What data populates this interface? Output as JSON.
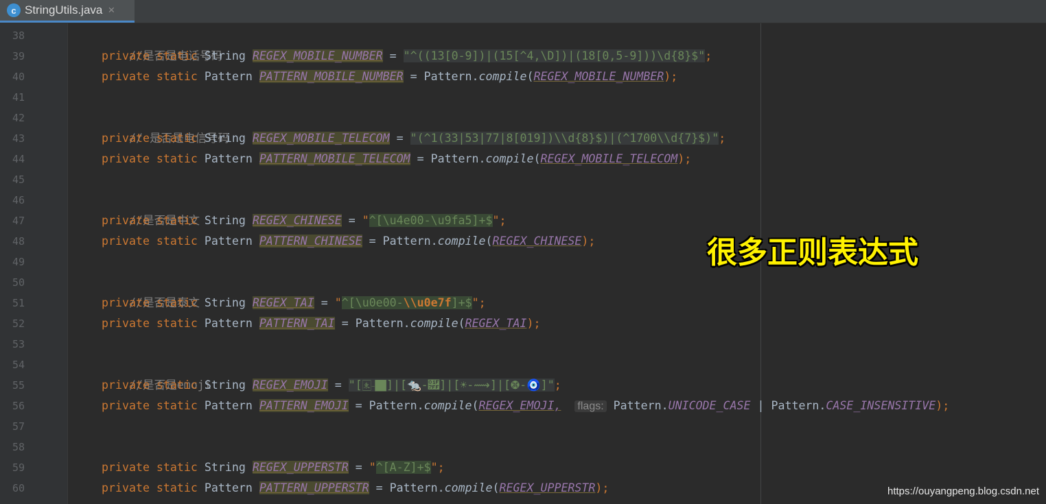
{
  "tab": {
    "icon_letter": "c",
    "icon": "class-icon",
    "title": "StringUtils.java",
    "close": "×"
  },
  "lines": [
    "38",
    "39",
    "40",
    "41",
    "42",
    "43",
    "44",
    "45",
    "46",
    "47",
    "48",
    "49",
    "50",
    "51",
    "52",
    "53",
    "54",
    "55",
    "56",
    "57",
    "58",
    "59",
    "60"
  ],
  "code": {
    "l38": {
      "comment": "//是否是电话号码"
    },
    "l39": {
      "kw": "private static",
      "type": "String",
      "field": "REGEX_MOBILE_NUMBER",
      "eq": " = ",
      "str": "\"^((13[0-9])|(15[^4,\\D])|(18[0,5-9]))\\d{8}$\"",
      "end": ";"
    },
    "l40": {
      "kw": "private static",
      "type": "Pattern",
      "field": "PATTERN_MOBILE_NUMBER",
      "eq": " = ",
      "call": "Pattern.",
      "method": "compile",
      "open": "(",
      "arg": "REGEX_MOBILE_NUMBER",
      "end": ");"
    },
    "l42": {
      "comment": "// 是否是电信号码"
    },
    "l43": {
      "kw": "private static",
      "type": "String",
      "field": "REGEX_MOBILE_TELECOM",
      "eq": " = ",
      "str": "\"(^1(33|53|77|8[019])\\\\d{8}$)|(^1700\\\\d{7}$)\"",
      "end": ";"
    },
    "l44": {
      "kw": "private static",
      "type": "Pattern",
      "field": "PATTERN_MOBILE_TELECOM",
      "eq": " = ",
      "call": "Pattern.",
      "method": "compile",
      "open": "(",
      "arg": "REGEX_MOBILE_TELECOM",
      "end": ");"
    },
    "l46": {
      "comment": "//是否是中文"
    },
    "l47": {
      "kw": "private static",
      "type": "String",
      "field": "REGEX_CHINESE",
      "eq": " = ",
      "q1": "\"",
      "str": "^[\\u4e00-\\u9fa5]+$",
      "q2": "\"",
      "end": ";"
    },
    "l48": {
      "kw": "private static",
      "type": "Pattern",
      "field": "PATTERN_CHINESE",
      "eq": " = ",
      "call": "Pattern.",
      "method": "compile",
      "open": "(",
      "arg": "REGEX_CHINESE",
      "end": ");"
    },
    "l50": {
      "comment": "//是否是泰文"
    },
    "l51": {
      "kw": "private static",
      "type": "String",
      "field": "REGEX_TAI",
      "eq": " = ",
      "q1": "\"",
      "str": "^[\\u0e00-",
      "esc": "\\\\u0e7f",
      "str2": "]+$",
      "q2": "\"",
      "end": ";"
    },
    "l52": {
      "kw": "private static",
      "type": "Pattern",
      "field": "PATTERN_TAI",
      "eq": " = ",
      "call": "Pattern.",
      "method": "compile",
      "open": "(",
      "arg": "REGEX_TAI",
      "end": ");"
    },
    "l54": {
      "comment": "//是否是emoji"
    },
    "l55": {
      "kw": "private static",
      "type": "String",
      "field": "REGEX_EMOJI",
      "eq": " = ",
      "str": "\"[🀀-🏿]|[🐀-🟿]|[☀-⟿]|[🤀-🧿]\"",
      "end": ";"
    },
    "l56": {
      "kw": "private static",
      "type": "Pattern",
      "field": "PATTERN_EMOJI",
      "eq": " = ",
      "call": "Pattern.",
      "method": "compile",
      "open": "(",
      "arg": "REGEX_EMOJI,",
      "hint": "flags:",
      "p1": "Pattern.",
      "c1": "UNICODE_CASE",
      "or": " | ",
      "p2": "Pattern.",
      "c2": "CASE_INSENSITIVE",
      "end": ");"
    },
    "l59": {
      "kw": "private static",
      "type": "String",
      "field": "REGEX_UPPERSTR",
      "eq": " = ",
      "q1": "\"",
      "str": "^[A-Z]+$",
      "q2": "\"",
      "end": ";"
    },
    "l60": {
      "kw": "private static",
      "type": "Pattern",
      "field": "PATTERN_UPPERSTR",
      "eq": " = ",
      "call": "Pattern.",
      "method": "compile",
      "open": "(",
      "arg": "REGEX_UPPERSTR",
      "end": ");"
    }
  },
  "overlay_text": "很多正则表达式",
  "watermark": "https://ouyangpeng.blog.csdn.net",
  "colors": {
    "keyword": "#cc7832",
    "string": "#6a8759",
    "field": "#9876aa",
    "comment": "#808080",
    "background": "#2b2b2b",
    "overlay": "#fff200"
  }
}
